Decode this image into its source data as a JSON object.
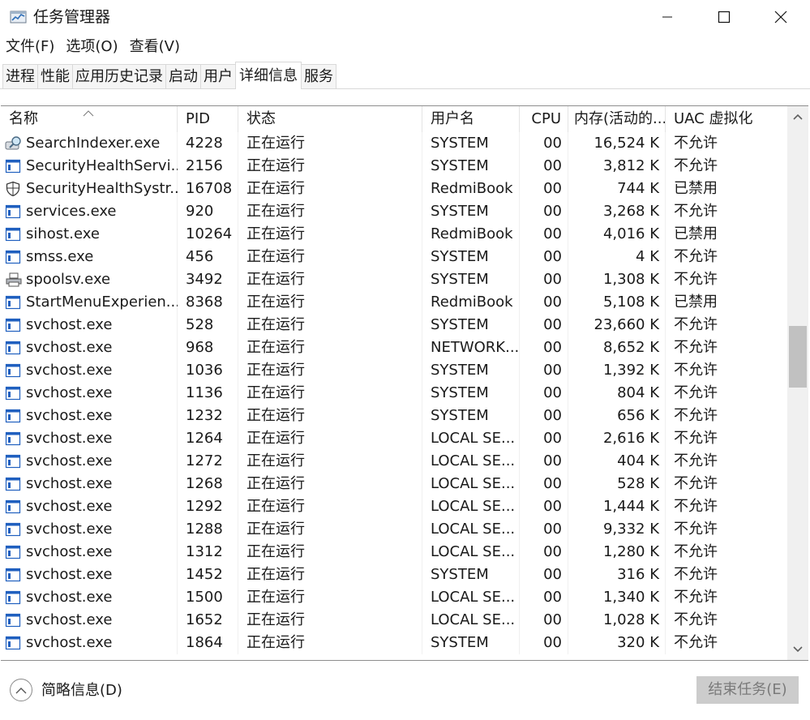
{
  "window": {
    "title": "任务管理器"
  },
  "menu": [
    "文件(F)",
    "选项(O)",
    "查看(V)"
  ],
  "tabs": [
    {
      "label": "进程",
      "active": false
    },
    {
      "label": "性能",
      "active": false
    },
    {
      "label": "应用历史记录",
      "active": false
    },
    {
      "label": "启动",
      "active": false
    },
    {
      "label": "用户",
      "active": false
    },
    {
      "label": "详细信息",
      "active": true
    },
    {
      "label": "服务",
      "active": false
    }
  ],
  "columns": [
    {
      "key": "name",
      "label": "名称"
    },
    {
      "key": "pid",
      "label": "PID"
    },
    {
      "key": "status",
      "label": "状态"
    },
    {
      "key": "user",
      "label": "用户名"
    },
    {
      "key": "cpu",
      "label": "CPU"
    },
    {
      "key": "mem",
      "label": "内存(活动的..."
    },
    {
      "key": "uac",
      "label": "UAC 虚拟化"
    }
  ],
  "sort": {
    "column": "name",
    "direction": "ascending"
  },
  "rows": [
    {
      "icon": "search-indexer-icon",
      "name": "SearchIndexer.exe",
      "pid": "4228",
      "status": "正在运行",
      "user": "SYSTEM",
      "cpu": "00",
      "mem": "16,524 K",
      "uac": "不允许"
    },
    {
      "icon": "app-window-icon",
      "name": "SecurityHealthServi...",
      "pid": "2156",
      "status": "正在运行",
      "user": "SYSTEM",
      "cpu": "00",
      "mem": "3,812 K",
      "uac": "不允许"
    },
    {
      "icon": "shield-icon",
      "name": "SecurityHealthSystr...",
      "pid": "16708",
      "status": "正在运行",
      "user": "RedmiBook",
      "cpu": "00",
      "mem": "744 K",
      "uac": "已禁用"
    },
    {
      "icon": "app-window-icon",
      "name": "services.exe",
      "pid": "920",
      "status": "正在运行",
      "user": "SYSTEM",
      "cpu": "00",
      "mem": "3,268 K",
      "uac": "不允许"
    },
    {
      "icon": "app-window-icon",
      "name": "sihost.exe",
      "pid": "10264",
      "status": "正在运行",
      "user": "RedmiBook",
      "cpu": "00",
      "mem": "4,016 K",
      "uac": "已禁用"
    },
    {
      "icon": "app-window-icon",
      "name": "smss.exe",
      "pid": "456",
      "status": "正在运行",
      "user": "SYSTEM",
      "cpu": "00",
      "mem": "4 K",
      "uac": "不允许"
    },
    {
      "icon": "printer-icon",
      "name": "spoolsv.exe",
      "pid": "3492",
      "status": "正在运行",
      "user": "SYSTEM",
      "cpu": "00",
      "mem": "1,308 K",
      "uac": "不允许"
    },
    {
      "icon": "app-window-icon",
      "name": "StartMenuExperien...",
      "pid": "8368",
      "status": "正在运行",
      "user": "RedmiBook",
      "cpu": "00",
      "mem": "5,108 K",
      "uac": "已禁用"
    },
    {
      "icon": "app-window-icon",
      "name": "svchost.exe",
      "pid": "528",
      "status": "正在运行",
      "user": "SYSTEM",
      "cpu": "00",
      "mem": "23,660 K",
      "uac": "不允许"
    },
    {
      "icon": "app-window-icon",
      "name": "svchost.exe",
      "pid": "968",
      "status": "正在运行",
      "user": "NETWORK...",
      "cpu": "00",
      "mem": "8,652 K",
      "uac": "不允许"
    },
    {
      "icon": "app-window-icon",
      "name": "svchost.exe",
      "pid": "1036",
      "status": "正在运行",
      "user": "SYSTEM",
      "cpu": "00",
      "mem": "1,392 K",
      "uac": "不允许"
    },
    {
      "icon": "app-window-icon",
      "name": "svchost.exe",
      "pid": "1136",
      "status": "正在运行",
      "user": "SYSTEM",
      "cpu": "00",
      "mem": "804 K",
      "uac": "不允许"
    },
    {
      "icon": "app-window-icon",
      "name": "svchost.exe",
      "pid": "1232",
      "status": "正在运行",
      "user": "SYSTEM",
      "cpu": "00",
      "mem": "656 K",
      "uac": "不允许"
    },
    {
      "icon": "app-window-icon",
      "name": "svchost.exe",
      "pid": "1264",
      "status": "正在运行",
      "user": "LOCAL SE...",
      "cpu": "00",
      "mem": "2,616 K",
      "uac": "不允许"
    },
    {
      "icon": "app-window-icon",
      "name": "svchost.exe",
      "pid": "1272",
      "status": "正在运行",
      "user": "LOCAL SE...",
      "cpu": "00",
      "mem": "404 K",
      "uac": "不允许"
    },
    {
      "icon": "app-window-icon",
      "name": "svchost.exe",
      "pid": "1268",
      "status": "正在运行",
      "user": "LOCAL SE...",
      "cpu": "00",
      "mem": "528 K",
      "uac": "不允许"
    },
    {
      "icon": "app-window-icon",
      "name": "svchost.exe",
      "pid": "1292",
      "status": "正在运行",
      "user": "LOCAL SE...",
      "cpu": "00",
      "mem": "1,444 K",
      "uac": "不允许"
    },
    {
      "icon": "app-window-icon",
      "name": "svchost.exe",
      "pid": "1288",
      "status": "正在运行",
      "user": "LOCAL SE...",
      "cpu": "00",
      "mem": "9,332 K",
      "uac": "不允许"
    },
    {
      "icon": "app-window-icon",
      "name": "svchost.exe",
      "pid": "1312",
      "status": "正在运行",
      "user": "LOCAL SE...",
      "cpu": "00",
      "mem": "1,280 K",
      "uac": "不允许"
    },
    {
      "icon": "app-window-icon",
      "name": "svchost.exe",
      "pid": "1452",
      "status": "正在运行",
      "user": "SYSTEM",
      "cpu": "00",
      "mem": "316 K",
      "uac": "不允许"
    },
    {
      "icon": "app-window-icon",
      "name": "svchost.exe",
      "pid": "1500",
      "status": "正在运行",
      "user": "LOCAL SE...",
      "cpu": "00",
      "mem": "1,340 K",
      "uac": "不允许"
    },
    {
      "icon": "app-window-icon",
      "name": "svchost.exe",
      "pid": "1652",
      "status": "正在运行",
      "user": "LOCAL SE...",
      "cpu": "00",
      "mem": "1,028 K",
      "uac": "不允许"
    },
    {
      "icon": "app-window-icon",
      "name": "svchost.exe",
      "pid": "1864",
      "status": "正在运行",
      "user": "SYSTEM",
      "cpu": "00",
      "mem": "320 K",
      "uac": "不允许"
    }
  ],
  "footer": {
    "details_toggle_label": "简略信息(D)",
    "end_task_label": "结束任务(E)",
    "end_task_enabled": false
  },
  "icons": {
    "minimize": "minimize-icon",
    "maximize": "maximize-icon",
    "close": "close-icon",
    "app": "task-manager-icon",
    "collapse": "chevron-up-icon"
  },
  "colors": {
    "window_bg": "#ffffff",
    "tab_inactive_bg": "#f5f5f5",
    "scrollbar_track": "#f0f0f0",
    "scrollbar_thumb": "#c1c1c1",
    "disabled_button_bg": "#cccccc",
    "process_icon_blue": "#1f5fbf"
  }
}
